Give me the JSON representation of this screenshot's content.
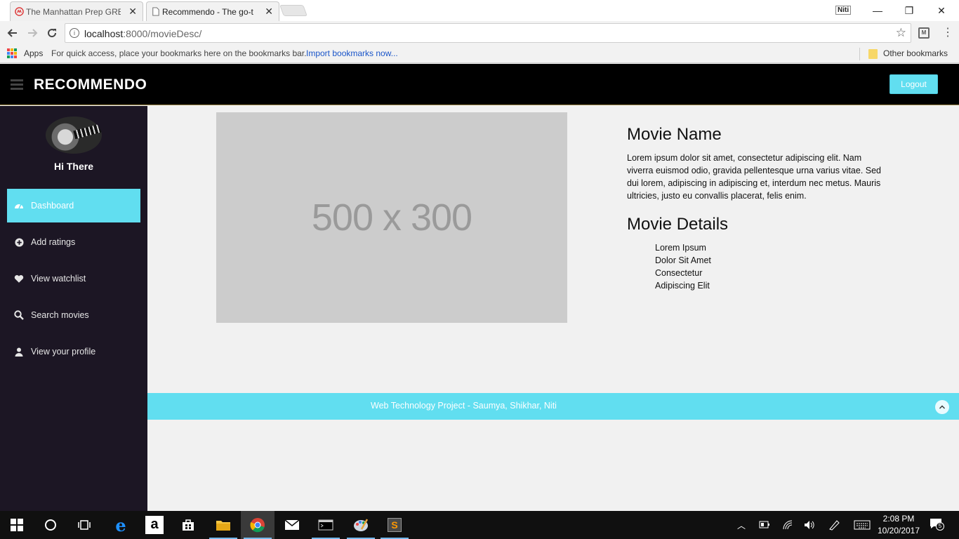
{
  "browser": {
    "tabs": [
      {
        "title": "The Manhattan Prep GRE",
        "active": false
      },
      {
        "title": "Recommendo - The go-t",
        "active": true
      }
    ],
    "profile_name": "Niti",
    "url_host": "localhost",
    "url_rest": ":8000/movieDesc/",
    "bookmarks": {
      "apps_label": "Apps",
      "hint": "For quick access, place your bookmarks here on the bookmarks bar.",
      "import_link": "Import bookmarks now...",
      "other_label": "Other bookmarks"
    }
  },
  "header": {
    "brand": "RECOMMENDO",
    "logout_label": "Logout"
  },
  "sidebar": {
    "greeting": "Hi There",
    "items": [
      {
        "label": "Dashboard",
        "icon": "dashboard-icon",
        "active": true
      },
      {
        "label": "Add ratings",
        "icon": "plus-circle-icon",
        "active": false
      },
      {
        "label": "View watchlist",
        "icon": "heart-icon",
        "active": false
      },
      {
        "label": "Search movies",
        "icon": "search-icon",
        "active": false
      },
      {
        "label": "View your profile",
        "icon": "user-icon",
        "active": false
      }
    ]
  },
  "main": {
    "image_placeholder": "500 x 300",
    "movie_name": "Movie Name",
    "description": "Lorem ipsum dolor sit amet, consectetur adipiscing elit. Nam viverra euismod odio, gravida pellentesque urna varius vitae. Sed dui lorem, adipiscing in adipiscing et, interdum nec metus. Mauris ultricies, justo eu convallis placerat, felis enim.",
    "details_title": "Movie Details",
    "details": [
      "Lorem Ipsum",
      "Dolor Sit Amet",
      "Consectetur",
      "Adipiscing Elit"
    ]
  },
  "footer": {
    "text": "Web Technology Project - Saumya, Shikhar, Niti"
  },
  "taskbar": {
    "time": "2:08 PM",
    "date": "10/20/2017",
    "notification_count": "5"
  },
  "colors": {
    "accent": "#61def0",
    "sidebar_bg": "#1c1624",
    "header_bg": "#000000"
  }
}
